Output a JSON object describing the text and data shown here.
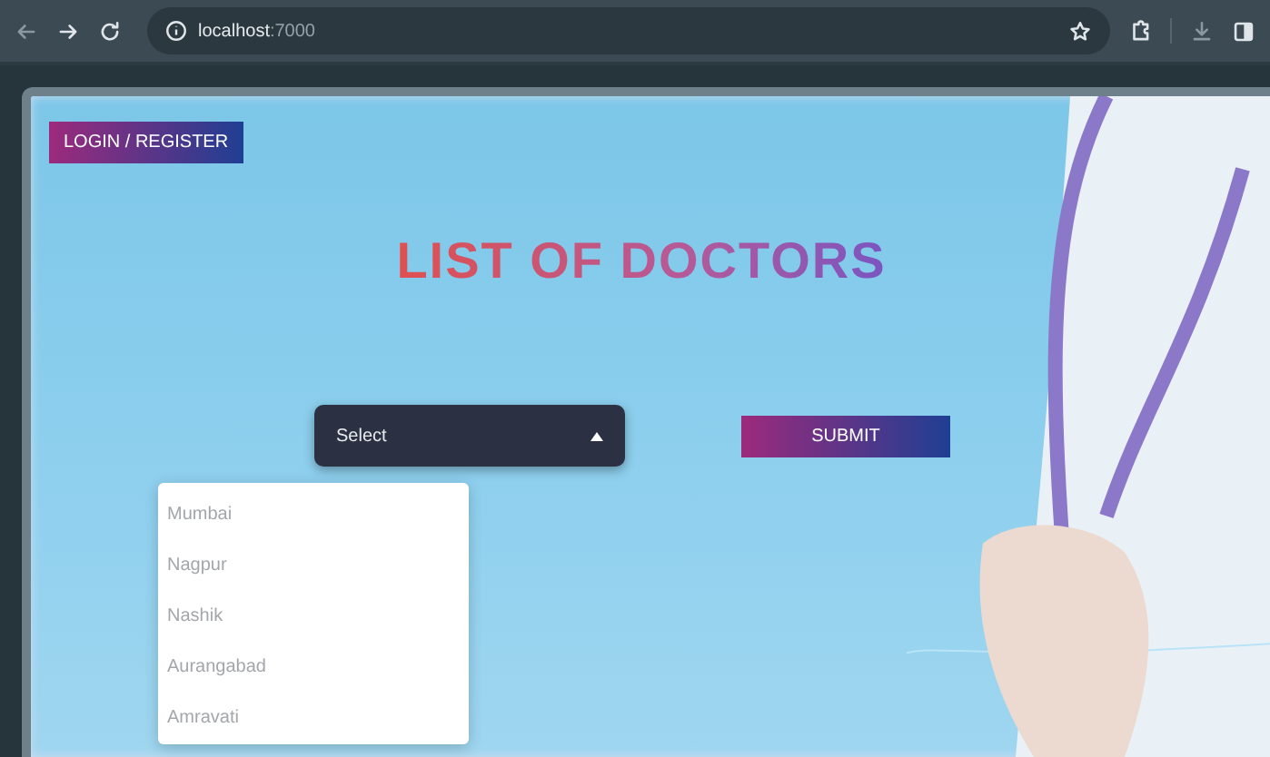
{
  "browser": {
    "host": "localhost",
    "port": ":7000"
  },
  "page": {
    "login_button": "LOGIN / REGISTER",
    "title": "LIST OF DOCTORS",
    "city_select": {
      "value": "Select",
      "expanded": true,
      "options": [
        {
          "label": "Mumbai",
          "selected": false
        },
        {
          "label": "Nagpur",
          "selected": false
        },
        {
          "label": "Nashik",
          "selected": false
        },
        {
          "label": "Aurangabad",
          "selected": false
        },
        {
          "label": "Amravati",
          "selected": false
        }
      ]
    },
    "submit_button": "SUBMIT"
  }
}
